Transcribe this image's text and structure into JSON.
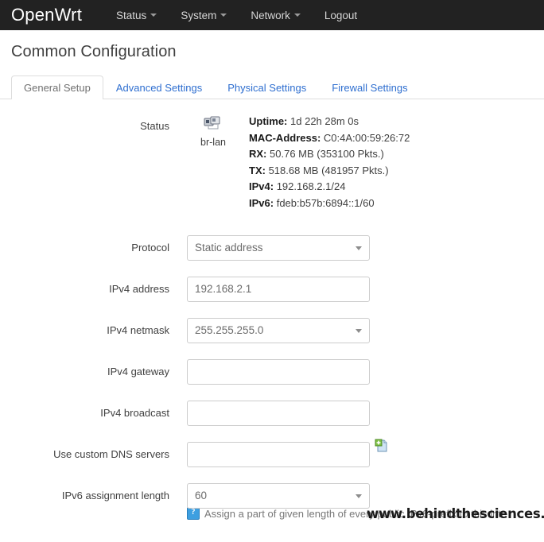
{
  "navbar": {
    "brand": "OpenWrt",
    "items": [
      {
        "label": "Status",
        "has_caret": true
      },
      {
        "label": "System",
        "has_caret": true
      },
      {
        "label": "Network",
        "has_caret": true
      },
      {
        "label": "Logout",
        "has_caret": false
      }
    ]
  },
  "page": {
    "title": "Common Configuration"
  },
  "tabs": [
    {
      "label": "General Setup",
      "active": true
    },
    {
      "label": "Advanced Settings",
      "active": false
    },
    {
      "label": "Physical Settings",
      "active": false
    },
    {
      "label": "Firewall Settings",
      "active": false
    }
  ],
  "form": {
    "status": {
      "label": "Status",
      "interface_icon": "network-bridge-icon",
      "interface_name": "br-lan",
      "entries": [
        {
          "key": "Uptime:",
          "value": "1d 22h 28m 0s"
        },
        {
          "key": "MAC-Address:",
          "value": "C0:4A:00:59:26:72"
        },
        {
          "key": "RX:",
          "value": "50.76 MB (353100 Pkts.)"
        },
        {
          "key": "TX:",
          "value": "518.68 MB (481957 Pkts.)"
        },
        {
          "key": "IPv4:",
          "value": "192.168.2.1/24"
        },
        {
          "key": "IPv6:",
          "value": "fdeb:b57b:6894::1/60"
        }
      ]
    },
    "protocol": {
      "label": "Protocol",
      "value": "Static address"
    },
    "ipv4_address": {
      "label": "IPv4 address",
      "value": "192.168.2.1",
      "placeholder": ""
    },
    "ipv4_netmask": {
      "label": "IPv4 netmask",
      "value": "255.255.255.0"
    },
    "ipv4_gateway": {
      "label": "IPv4 gateway",
      "value": "",
      "placeholder": ""
    },
    "ipv4_broadcast": {
      "label": "IPv4 broadcast",
      "value": "",
      "placeholder": ""
    },
    "custom_dns": {
      "label": "Use custom DNS servers",
      "value": "",
      "placeholder": "",
      "add_icon": "add-page-icon"
    },
    "ipv6_assignment_length": {
      "label": "IPv6 assignment length",
      "value": "60",
      "help": "Assign a part of given length of every public IPv6-prefix to this inte"
    }
  },
  "watermark": {
    "text": "www.behindthesciences.com©"
  },
  "colors": {
    "navbar_bg": "#222222",
    "link_blue": "#2f6fd0",
    "border_gray": "#cccccc",
    "text": "#404040"
  }
}
